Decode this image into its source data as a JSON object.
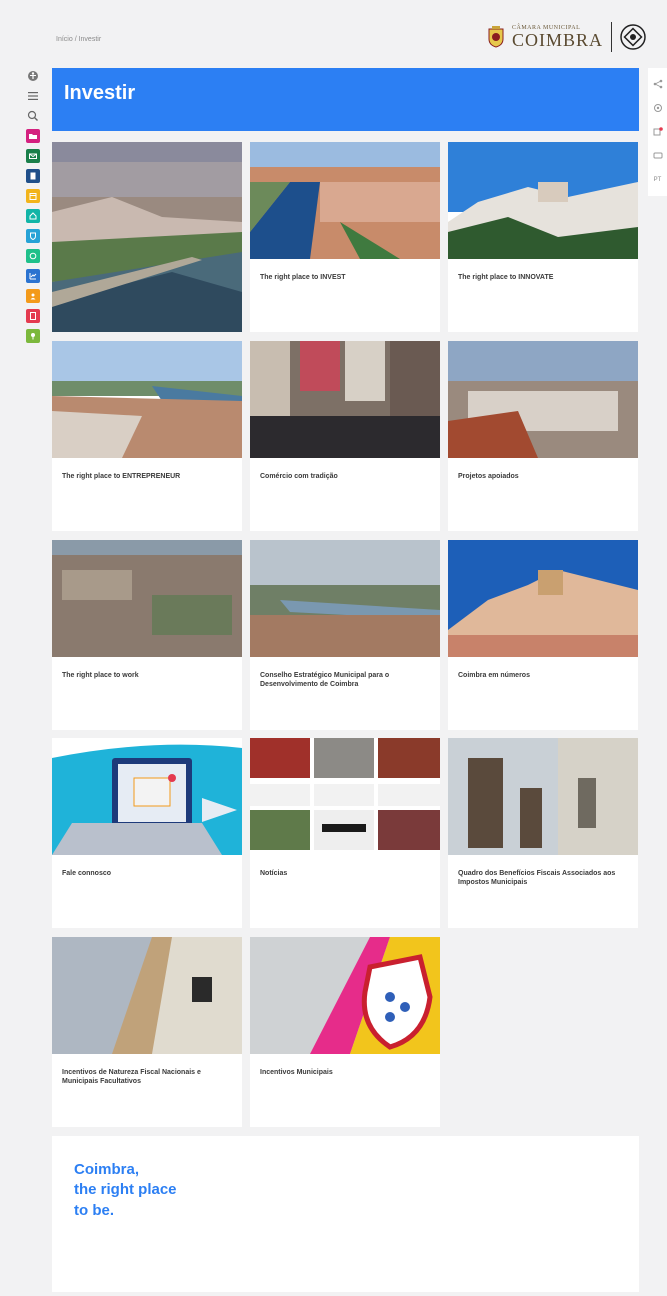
{
  "breadcrumb": {
    "home": "Início",
    "separator": "/",
    "current": "Investir"
  },
  "logo": {
    "small": "CÂMARA MUNICIPAL",
    "big": "COIMBRA"
  },
  "page": {
    "title": "Investir"
  },
  "leftbar": {
    "icons": [
      {
        "name": "accessibility-icon",
        "color": "#666"
      },
      {
        "name": "menu-icon",
        "color": "#666"
      },
      {
        "name": "search-icon",
        "color": "#666"
      }
    ],
    "squares": [
      {
        "name": "folder-icon",
        "color": "#d4217f"
      },
      {
        "name": "mail-icon",
        "color": "#1a7f4a"
      },
      {
        "name": "document-icon",
        "color": "#1f4f8a"
      },
      {
        "name": "calendar-icon",
        "color": "#f2b41b"
      },
      {
        "name": "house-icon",
        "color": "#12b5a7"
      },
      {
        "name": "shield-icon",
        "color": "#27a3d6"
      },
      {
        "name": "leaf-icon",
        "color": "#1fc08a"
      },
      {
        "name": "chart-icon",
        "color": "#2b73d0"
      },
      {
        "name": "user-icon",
        "color": "#f39a1a"
      },
      {
        "name": "file-icon",
        "color": "#e43a4f"
      },
      {
        "name": "tree-icon",
        "color": "#7cb83c"
      }
    ]
  },
  "rightbar": {
    "lang": "PT"
  },
  "cards": [
    {
      "label": "",
      "name": "card-coimbra-river"
    },
    {
      "label": "The right place to INVEST",
      "name": "card-invest"
    },
    {
      "label": "The right place to INNOVATE",
      "name": "card-innovate"
    },
    {
      "label": "The right place to ENTREPRENEUR",
      "name": "card-entrepreneur"
    },
    {
      "label": "Comércio com tradição",
      "name": "card-comercio"
    },
    {
      "label": "Projetos apoiados",
      "name": "card-projetos"
    },
    {
      "label": "The right place to work",
      "name": "card-work"
    },
    {
      "label": "Conselho Estratégico Municipal para o Desenvolvimento de Coimbra",
      "name": "card-conselho"
    },
    {
      "label": "Coimbra em números",
      "name": "card-numeros"
    },
    {
      "label": "Fale connosco",
      "name": "card-fale"
    },
    {
      "label": "Notícias",
      "name": "card-noticias"
    },
    {
      "label": "Quadro dos Benefícios Fiscais Associados aos Impostos Municipais",
      "name": "card-quadro"
    },
    {
      "label": "Incentivos de Natureza Fiscal Nacionais e Municipais Facultativos",
      "name": "card-incentivos-fiscais"
    },
    {
      "label": "Incentivos Municipais",
      "name": "card-incentivos-municipais"
    }
  ],
  "footer": {
    "line1": "Coimbra,",
    "line2": "the right place",
    "line3": "to be."
  }
}
